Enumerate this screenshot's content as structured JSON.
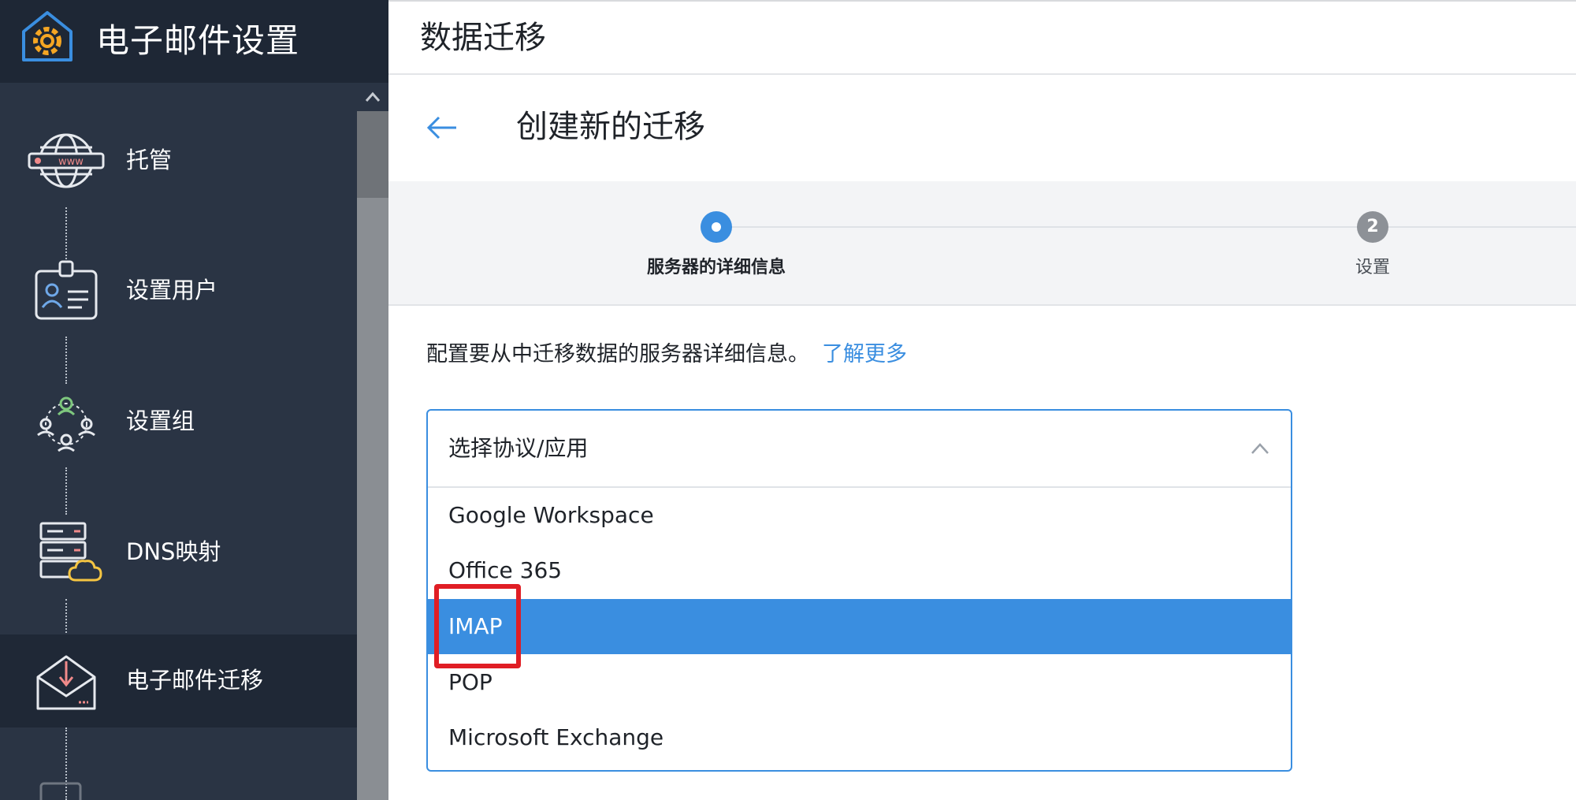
{
  "sidebar": {
    "title": "电子邮件设置",
    "items": [
      {
        "label": "托管",
        "icon": "globe-www-icon"
      },
      {
        "label": "设置用户",
        "icon": "user-badge-icon"
      },
      {
        "label": "设置组",
        "icon": "group-icon"
      },
      {
        "label": "DNS映射",
        "icon": "dns-server-cloud-icon"
      },
      {
        "label": "电子邮件迁移",
        "icon": "mail-migration-icon",
        "active": true
      }
    ]
  },
  "header": {
    "title": "数据迁移"
  },
  "subheader": {
    "title": "创建新的迁移"
  },
  "stepper": {
    "steps": [
      {
        "label": "服务器的详细信息",
        "state": "active"
      },
      {
        "number": "2",
        "label": "设置",
        "state": "pending"
      }
    ]
  },
  "content": {
    "description": "配置要从中迁移数据的服务器详细信息。",
    "learn_more": "了解更多"
  },
  "select": {
    "placeholder": "选择协议/应用",
    "options": [
      "Google Workspace",
      "Office 365",
      "IMAP",
      "POP",
      "Microsoft Exchange"
    ],
    "highlighted": "IMAP"
  },
  "colors": {
    "sidebar_bg": "#2a3444",
    "sidebar_header_bg": "#1e2735",
    "accent": "#3a8ee0",
    "highlight_border": "#e01e25",
    "brand_icon": "#f5a623"
  }
}
